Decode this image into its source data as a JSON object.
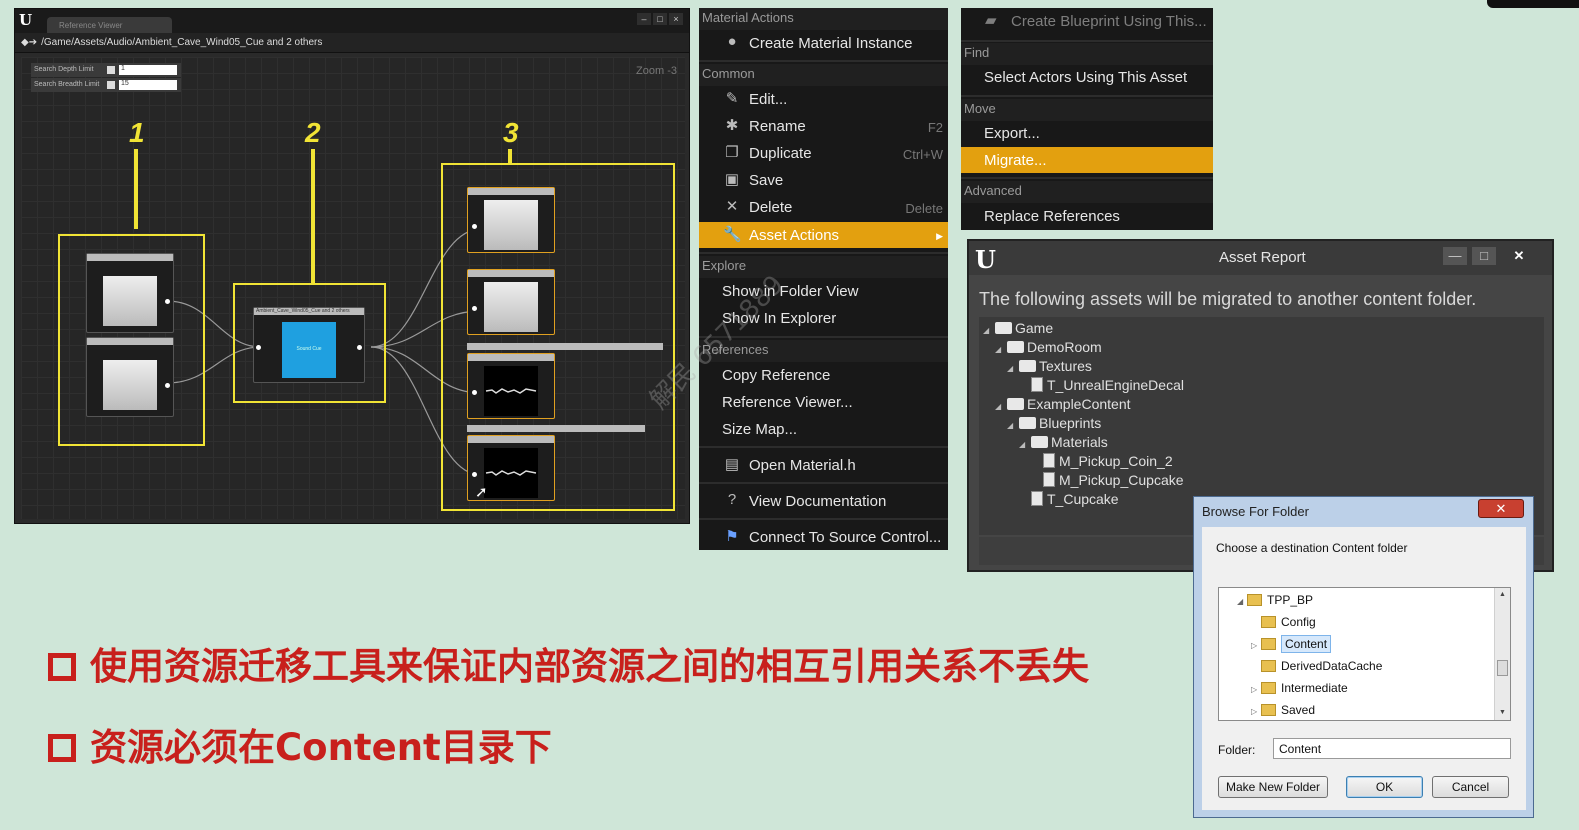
{
  "reference_viewer": {
    "tab_label": "Reference Viewer",
    "window_buttons": [
      "–",
      "□",
      "×"
    ],
    "nav_arrows": "◆➔",
    "path": "/Game/Assets/Audio/Ambient_Cave_Wind05_Cue and 2 others",
    "search_depth_label": "Search Depth Limit",
    "search_depth_value": "1",
    "search_breadth_label": "Search Breadth Limit",
    "search_breadth_value": "15",
    "zoom": "Zoom -3",
    "columns": [
      "1",
      "2",
      "3"
    ],
    "center_node_label": "Ambient_Cave_Wind05_Cue and 2 others",
    "center_node_thumb": "Sound Cue"
  },
  "context_menu": {
    "sections": {
      "material_actions": "Material Actions",
      "common": "Common",
      "explore": "Explore",
      "references": "References"
    },
    "items": {
      "create_material_instance": "Create Material Instance",
      "edit": "Edit...",
      "rename": "Rename",
      "rename_shortcut": "F2",
      "duplicate": "Duplicate",
      "duplicate_shortcut": "Ctrl+W",
      "save": "Save",
      "delete": "Delete",
      "delete_shortcut": "Delete",
      "asset_actions": "Asset Actions",
      "show_in_folder_view": "Show in Folder View",
      "show_in_explorer": "Show In Explorer",
      "copy_reference": "Copy Reference",
      "reference_viewer": "Reference Viewer...",
      "size_map": "Size Map...",
      "open_material_h": "Open Material.h",
      "view_documentation": "View Documentation",
      "connect_source_control": "Connect To Source Control..."
    }
  },
  "menu2": {
    "create_blueprint": "Create Blueprint Using This...",
    "find_section": "Find",
    "select_actors": "Select Actors Using This Asset",
    "move_section": "Move",
    "export": "Export...",
    "migrate": "Migrate...",
    "advanced_section": "Advanced",
    "replace_references": "Replace References"
  },
  "asset_report": {
    "title": "Asset Report",
    "message": "The following assets will be migrated to another content folder.",
    "tree": {
      "game": "Game",
      "demoroom": "DemoRoom",
      "textures": "Textures",
      "t_unreal_engine_decal": "T_UnrealEngineDecal",
      "example_content": "ExampleContent",
      "blueprints": "Blueprints",
      "materials": "Materials",
      "m_pickup_coin_2": "M_Pickup_Coin_2",
      "m_pickup_cupcake": "M_Pickup_Cupcake",
      "t_cupcake": "T_Cupcake"
    }
  },
  "browse_for_folder": {
    "title": "Browse For Folder",
    "close": "✕",
    "instruction": "Choose a destination Content folder",
    "tree": {
      "tpp_bp": "TPP_BP",
      "config": "Config",
      "content": "Content",
      "derived_data_cache": "DerivedDataCache",
      "intermediate": "Intermediate",
      "saved": "Saved"
    },
    "folder_label": "Folder:",
    "folder_value": "Content",
    "make_new_folder": "Make New Folder",
    "ok": "OK",
    "cancel": "Cancel"
  },
  "bullets": [
    "使用资源迁移工具来保证内部资源之间的相互引用关系不丢失",
    "资源必须在Content目录下"
  ],
  "watermark": "解民 6571889"
}
